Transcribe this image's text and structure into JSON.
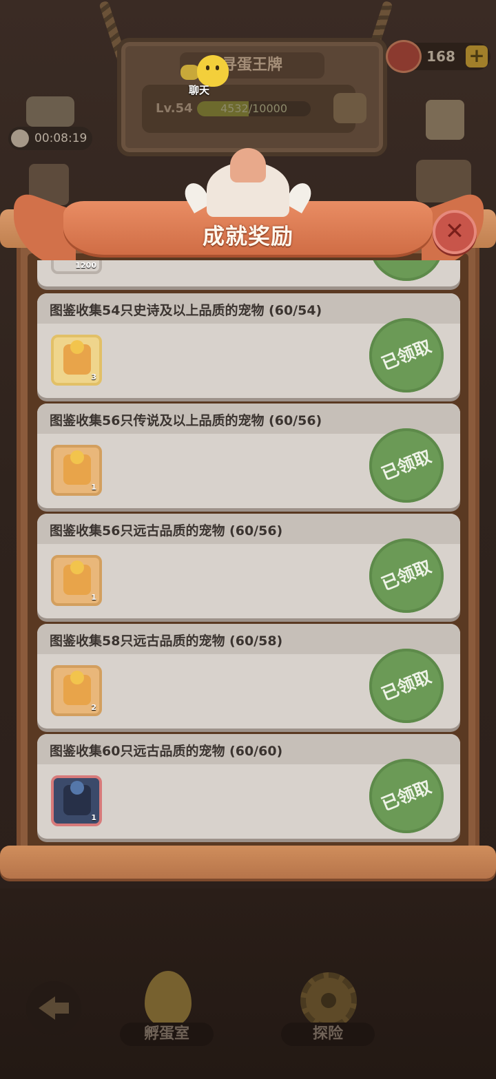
{
  "hud": {
    "sign_title": "寻蛋王牌",
    "level_label": "Lv.54",
    "exp_text": "4532/10000",
    "exp_fraction": 0.4532,
    "chat_label": "聊天",
    "meat_count": "168",
    "plus_label": "+",
    "timer": "00:08:19"
  },
  "modal": {
    "title": "成就奖励",
    "close_label": "✕"
  },
  "achievements": [
    {
      "title": "",
      "reward_count": "1200",
      "status": "已领取",
      "partial": true
    },
    {
      "title": "图鉴收集54只史诗及以上品质的宠物 (60/54)",
      "reward_count": "3",
      "status": "已领取",
      "tier": "gold"
    },
    {
      "title": "图鉴收集56只传说及以上品质的宠物 (60/56)",
      "reward_count": "1",
      "status": "已领取",
      "tier": "orange"
    },
    {
      "title": "图鉴收集56只远古品质的宠物 (60/56)",
      "reward_count": "1",
      "status": "已领取",
      "tier": "orange"
    },
    {
      "title": "图鉴收集58只远古品质的宠物 (60/58)",
      "reward_count": "2",
      "status": "已领取",
      "tier": "orange"
    },
    {
      "title": "图鉴收集60只远古品质的宠物 (60/60)",
      "reward_count": "1",
      "status": "已领取",
      "tier": "red"
    }
  ],
  "bottom_nav": {
    "hatch_label": "孵蛋室",
    "explore_label": "探险"
  },
  "colors": {
    "stamp_green": "#6b9a56",
    "ribbon": "#e98d64",
    "card": "#d8d2cc"
  }
}
